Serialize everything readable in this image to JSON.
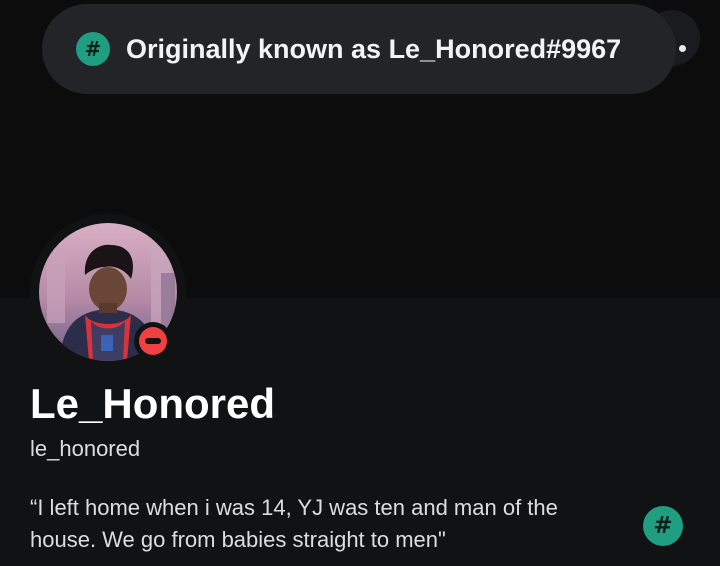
{
  "tooltip": {
    "badge_icon": "hashtag-icon",
    "text": "Originally known as Le_Honored#9967"
  },
  "header": {
    "menu_icon": "dot-icon"
  },
  "profile": {
    "display_name": "Le_Honored",
    "username": "le_honored",
    "status": "do-not-disturb",
    "bio": "“I left home when i was 14, YJ was ten and man of the house. We go from babies straight to men\"",
    "bio_badge_icon": "hashtag-icon"
  },
  "colors": {
    "badge": "#1f9e82",
    "status_dnd": "#f23f43",
    "pill": "#232428",
    "banner": "#0c0c0d",
    "background": "#111214"
  }
}
